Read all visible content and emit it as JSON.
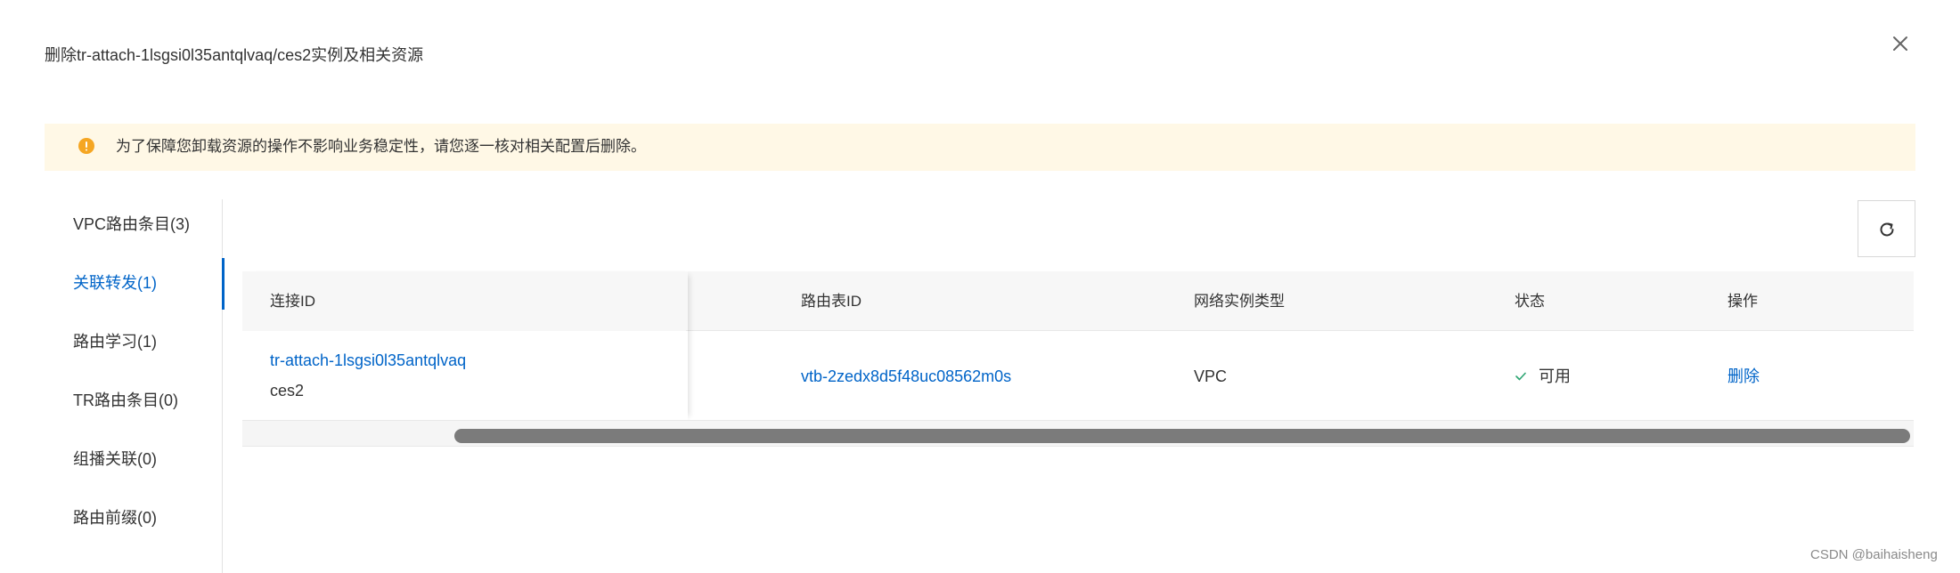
{
  "dialog": {
    "title": "删除tr-attach-1lsgsi0l35antqlvaq/ces2实例及相关资源",
    "close_icon": "close-icon"
  },
  "alert": {
    "icon": "warning-icon",
    "text": "为了保障您卸载资源的操作不影响业务稳定性，请您逐一核对相关配置后删除。",
    "color": "#fff8e6"
  },
  "tabs": [
    {
      "label": "VPC路由条目(3)",
      "active": false
    },
    {
      "label": "关联转发(1)",
      "active": true
    },
    {
      "label": "路由学习(1)",
      "active": false
    },
    {
      "label": "TR路由条目(0)",
      "active": false
    },
    {
      "label": "组播关联(0)",
      "active": false
    },
    {
      "label": "路由前缀(0)",
      "active": false
    }
  ],
  "toolbar": {
    "refresh_icon": "refresh-icon"
  },
  "table": {
    "columns": [
      "连接ID",
      "路由表ID",
      "网络实例类型",
      "状态",
      "操作"
    ],
    "rows": [
      {
        "attachment_id": "tr-attach-1lsgsi0l35antqlvaq",
        "attachment_name": "ces2",
        "route_table_id": "vtb-2zedx8d5f48uc08562m0s",
        "instance_type": "VPC",
        "status": "可用",
        "action": "删除"
      }
    ]
  },
  "watermark": "CSDN @baihaisheng",
  "colors": {
    "accent": "#0064c8",
    "success": "#2ba471",
    "warning": "#f5a623"
  }
}
